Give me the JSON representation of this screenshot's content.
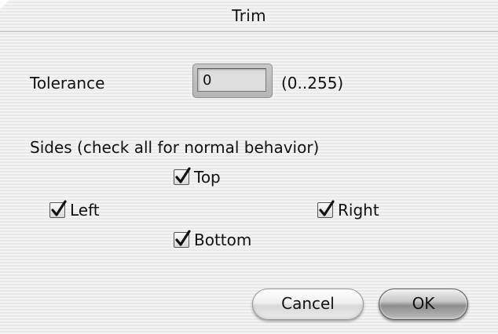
{
  "dialog": {
    "title": "Trim"
  },
  "tolerance": {
    "label": "Tolerance",
    "value": "0",
    "range_hint": "(0..255)"
  },
  "sides": {
    "heading": "Sides (check all for normal behavior)",
    "top": {
      "label": "Top",
      "checked": true
    },
    "left": {
      "label": "Left",
      "checked": true
    },
    "right": {
      "label": "Right",
      "checked": true
    },
    "bottom": {
      "label": "Bottom",
      "checked": true
    }
  },
  "buttons": {
    "cancel_label": "Cancel",
    "ok_label": "OK"
  },
  "icons": {
    "checkbox_mark": "checkmark-icon"
  }
}
